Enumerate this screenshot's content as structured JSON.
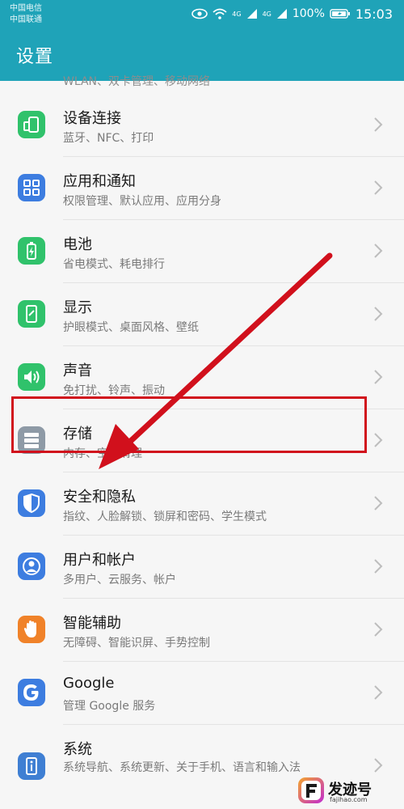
{
  "status_bar": {
    "carrier1": "中国电信",
    "carrier2": "中国联通",
    "signal1_label": "4G",
    "signal2_label": "4G",
    "battery": "100%",
    "time": "15:03"
  },
  "app_bar": {
    "title": "设置"
  },
  "partial_item_subtitle": "WLAN、双卡管理、移动网络",
  "settings": [
    {
      "title": "设备连接",
      "subtitle": "蓝牙、NFC、打印",
      "icon": "device-connection-icon",
      "color": "#30c26b"
    },
    {
      "title": "应用和通知",
      "subtitle": "权限管理、默认应用、应用分身",
      "icon": "apps-icon",
      "color": "#3d7de0"
    },
    {
      "title": "电池",
      "subtitle": "省电模式、耗电排行",
      "icon": "battery-icon",
      "color": "#30c26b"
    },
    {
      "title": "显示",
      "subtitle": "护眼模式、桌面风格、壁纸",
      "icon": "display-icon",
      "color": "#30c26b"
    },
    {
      "title": "声音",
      "subtitle": "免打扰、铃声、振动",
      "icon": "sound-icon",
      "color": "#30c26b"
    },
    {
      "title": "存储",
      "subtitle": "内存、空间清理",
      "icon": "storage-icon",
      "color": "#8e9aa6"
    },
    {
      "title": "安全和隐私",
      "subtitle": "指纹、人脸解锁、锁屏和密码、学生模式",
      "icon": "shield-icon",
      "color": "#3d7de0"
    },
    {
      "title": "用户和帐户",
      "subtitle": "多用户、云服务、帐户",
      "icon": "user-icon",
      "color": "#3d7de0"
    },
    {
      "title": "智能辅助",
      "subtitle": "无障碍、智能识屏、手势控制",
      "icon": "hand-icon",
      "color": "#f08229"
    },
    {
      "title": "Google",
      "subtitle": "管理 Google 服务",
      "icon": "google-icon",
      "color": "#3d7de0"
    },
    {
      "title": "系统",
      "subtitle": "系统导航、系统更新、关于手机、语言和输入法",
      "icon": "system-info-icon",
      "color": "#3f7fd3"
    }
  ],
  "watermark": {
    "brand": "发迹号",
    "domain": "fajihao.com"
  }
}
